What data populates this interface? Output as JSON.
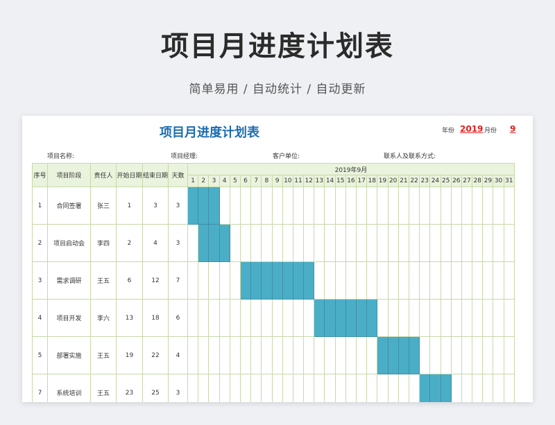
{
  "hero": {
    "title": "项目月进度计划表",
    "subtitle": "简单易用  /  自动统计  /  自动更新"
  },
  "sheet": {
    "title": "项目月进度计划表",
    "year_label": "年份",
    "year_value": "2019",
    "month_label": "月份",
    "month_value": "9",
    "project_name_label": "项目名称:",
    "project_manager_label": "项目经理:",
    "client_label": "客户单位:",
    "contact_label": "联系人及联系方式:"
  },
  "table": {
    "headers": {
      "seq": "序号",
      "stage": "项目阶段",
      "owner": "责任人",
      "start": "开始日期",
      "end": "结束日期",
      "days": "天数",
      "month_group": "2019年9月"
    },
    "days_in_month": 31,
    "bar_color": "#4baec7",
    "rows": [
      {
        "seq": "1",
        "stage": "合同签署",
        "owner": "张三",
        "start": "1",
        "end": "3",
        "days": "3"
      },
      {
        "seq": "2",
        "stage": "项目启动会",
        "owner": "李四",
        "start": "2",
        "end": "4",
        "days": "3"
      },
      {
        "seq": "3",
        "stage": "需求调研",
        "owner": "王五",
        "start": "6",
        "end": "12",
        "days": "7"
      },
      {
        "seq": "4",
        "stage": "项目开发",
        "owner": "李六",
        "start": "13",
        "end": "18",
        "days": "6"
      },
      {
        "seq": "5",
        "stage": "部署实施",
        "owner": "王五",
        "start": "19",
        "end": "22",
        "days": "4"
      },
      {
        "seq": "7",
        "stage": "系统培训",
        "owner": "王五",
        "start": "23",
        "end": "25",
        "days": "3"
      }
    ]
  }
}
